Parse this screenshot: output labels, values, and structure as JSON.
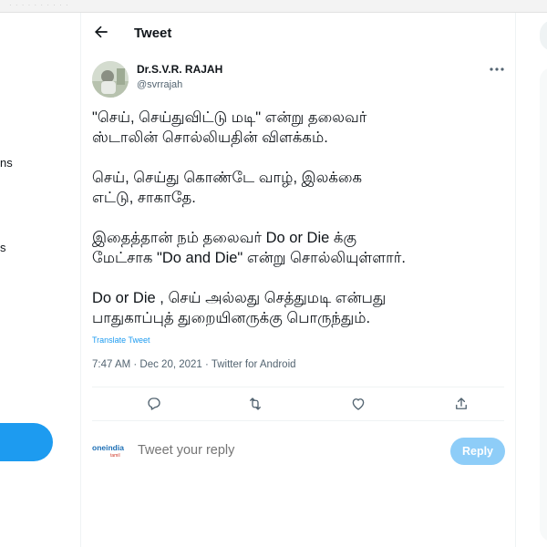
{
  "header": {
    "title": "Tweet"
  },
  "left_nav": {
    "fragments": [
      "ns",
      "s"
    ]
  },
  "tweet": {
    "author_name": "Dr.S.V.R. RAJAH",
    "author_handle": "@svrrajah",
    "paragraphs": [
      [
        "\"செய், செய்துவிட்டு மடி\" என்று தலைவர்",
        "ஸ்டாலின் சொல்லியதின் விளக்கம்."
      ],
      [
        "செய், செய்து கொண்டே வாழ், இலக்கை",
        "எட்டு, சாகாதே."
      ],
      [
        "இதைத்தான் நம் தலைவர் Do or Die க்கு",
        "மேட்சாக \"Do and Die\" என்று சொல்லியுள்ளார்."
      ],
      [
        "Do or Die , செய் அல்லது செத்துமடி என்பது",
        "பாதுகாப்புத் துறையினருக்கு பொருந்தும்."
      ]
    ],
    "translate_label": "Translate Tweet",
    "meta": "7:47 AM · Dec 20, 2021 · Twitter for Android"
  },
  "actions": [
    {
      "icon": "reply-icon"
    },
    {
      "icon": "retweet-icon"
    },
    {
      "icon": "like-icon"
    },
    {
      "icon": "share-icon"
    }
  ],
  "reply": {
    "logo_text": "oneindia",
    "logo_sub": "tamil",
    "placeholder": "Tweet your reply",
    "button_label": "Reply"
  },
  "colors": {
    "accent": "#1d9bf0",
    "reply_button": "#8ecdf8",
    "muted_text": "#536471"
  }
}
